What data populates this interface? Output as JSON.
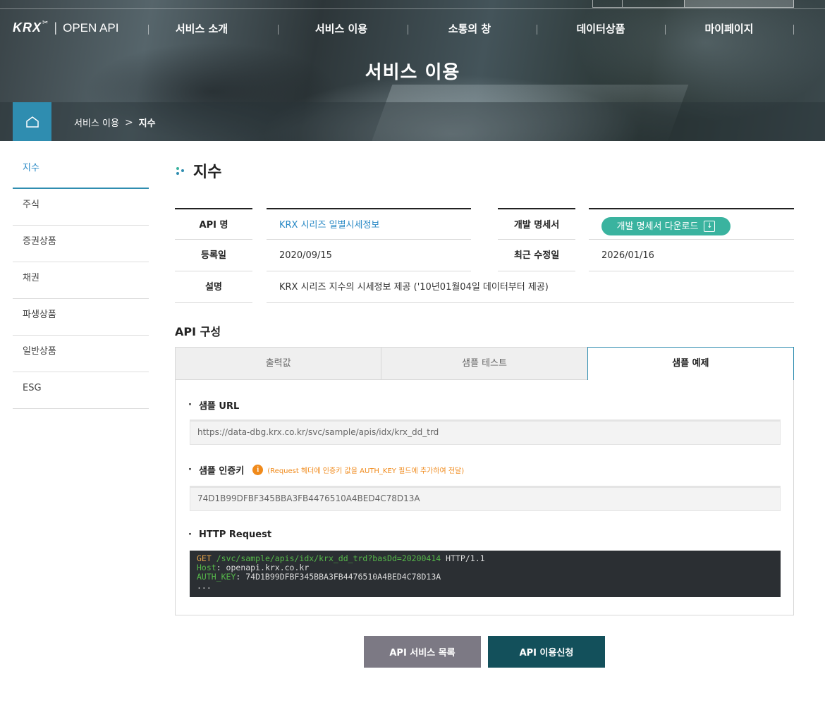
{
  "header": {
    "logo_brand": "KRX",
    "logo_product": "OPEN API",
    "nav": [
      "서비스 소개",
      "서비스 이용",
      "소통의 창",
      "데이터상품",
      "마이페이지"
    ],
    "page_title": "서비스 이용"
  },
  "breadcrumb": {
    "items": [
      "서비스 이용",
      "지수"
    ]
  },
  "sidebar": {
    "items": [
      {
        "label": "지수",
        "active": true
      },
      {
        "label": "주식"
      },
      {
        "label": "증권상품"
      },
      {
        "label": "채권"
      },
      {
        "label": "파생상품"
      },
      {
        "label": "일반상품"
      },
      {
        "label": "ESG"
      }
    ]
  },
  "main": {
    "title": "지수",
    "info": {
      "api_name_label": "API 명",
      "api_name_value": "KRX 시리즈 일별시세정보",
      "spec_label": "개발 명세서",
      "spec_button": "개발 명세서 다운로드",
      "reg_label": "등록일",
      "reg_value": "2020/09/15",
      "mod_label": "최근 수정일",
      "mod_value": "2026/01/16",
      "desc_label": "설명",
      "desc_value": "KRX 시리즈 지수의 시세정보 제공 ('10년01월04일 데이터부터 제공)"
    },
    "section_title": "API 구성",
    "tabs": [
      "출력값",
      "샘플 테스트",
      "샘플 예제"
    ],
    "active_tab": 2,
    "sample": {
      "url_title": "샘플 URL",
      "url_value": "https://data-dbg.krx.co.kr/svc/sample/apis/idx/krx_dd_trd",
      "key_title": "샘플 인증키",
      "key_note": "(Request 헤더에 인증키 값을 AUTH_KEY 필드에 추가하여 전달)",
      "key_value": "74D1B99DFBF345BBA3FB4476510A4BED4C78D13A",
      "http_title": "HTTP Request",
      "http": {
        "method": "GET",
        "path": "/svc/sample/apis/idx/krx_dd_trd?basDd=20200414",
        "version": "HTTP/1.1",
        "host_key": "Host",
        "host_value": ": openapi.krx.co.kr",
        "auth_key": "AUTH_KEY",
        "auth_value": ": 74D1B99DFBF345BBA3FB4476510A4BED4C78D13A",
        "ellipsis": "..."
      }
    },
    "buttons": {
      "list": "API 서비스 목록",
      "apply": "API 이용신청"
    }
  },
  "colors": {
    "accent": "#2f8db0",
    "link": "#2788c5",
    "download": "#3ab39f",
    "note": "#f08a1b",
    "btn_gray": "#7c7984",
    "btn_dark": "#13505b"
  }
}
